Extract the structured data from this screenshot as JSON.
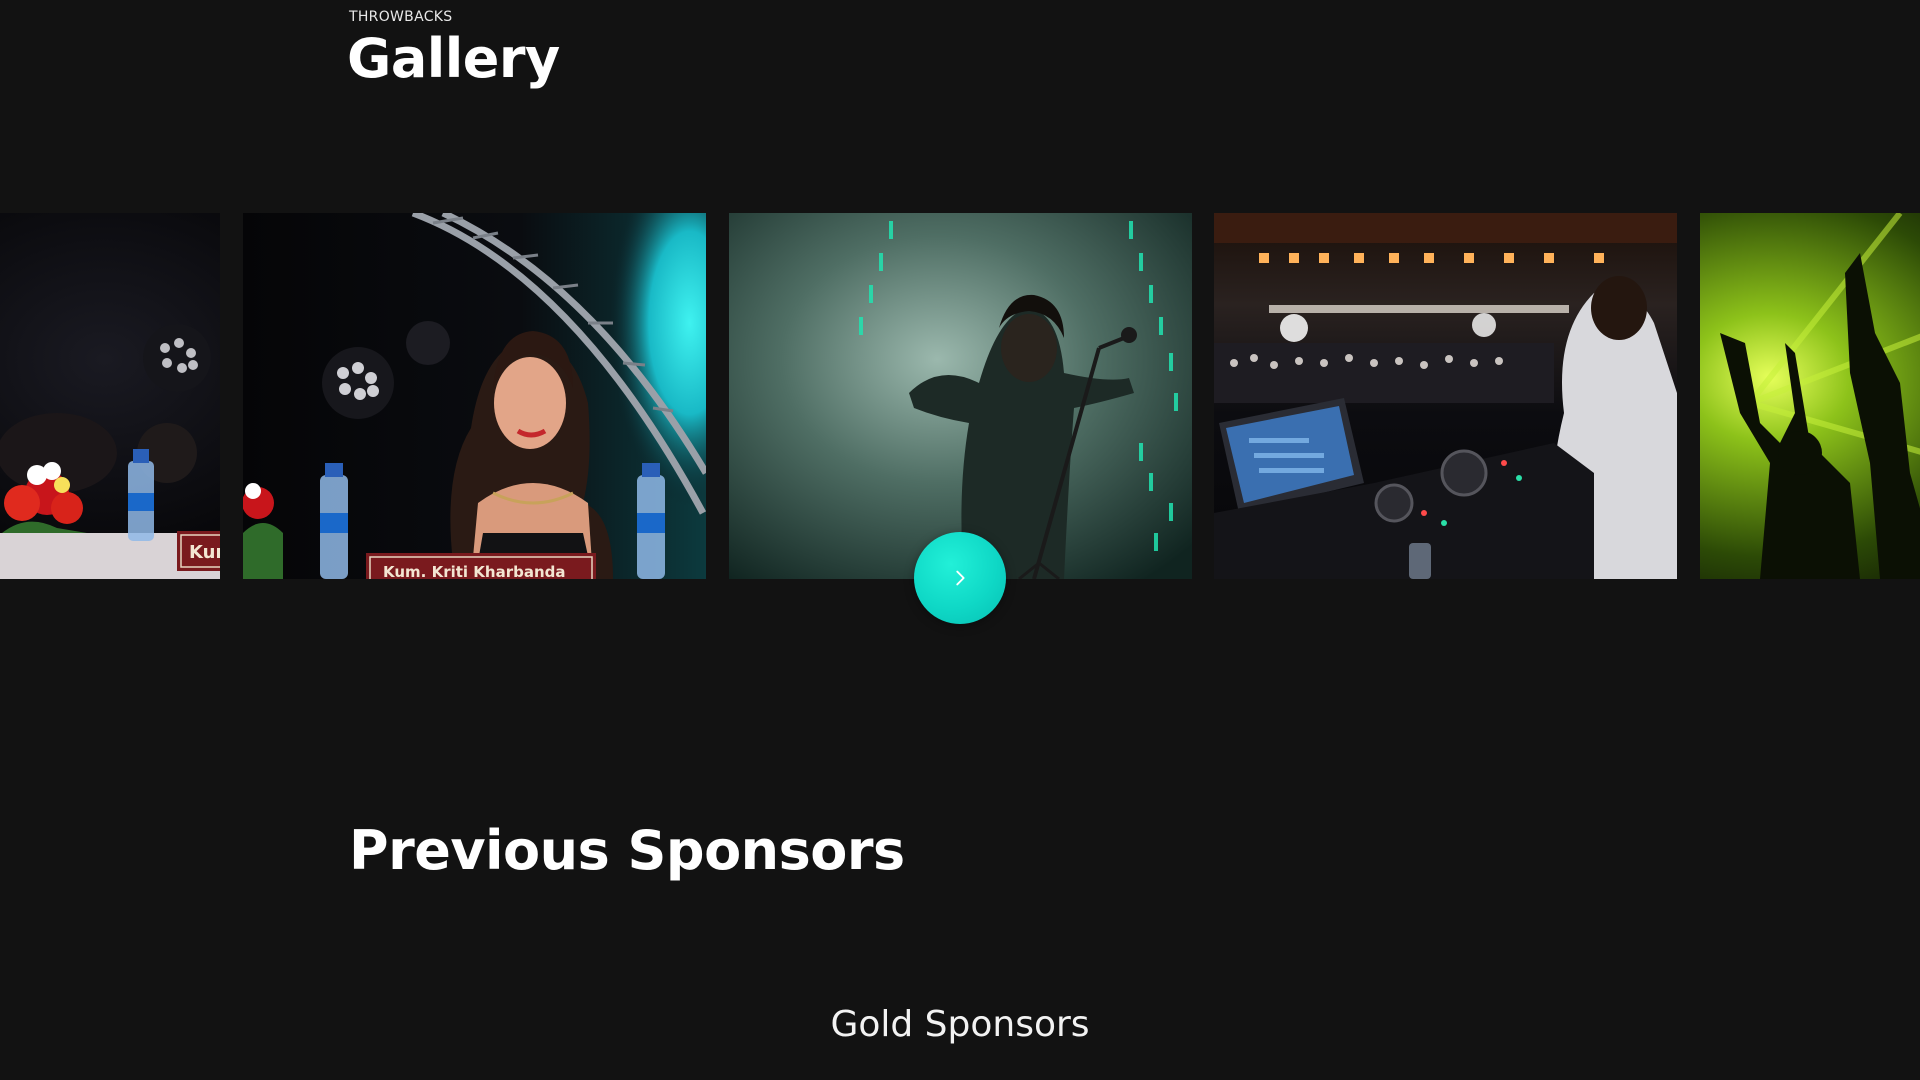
{
  "gallery": {
    "eyebrow": "THROWBACKS",
    "title": "Gallery",
    "slides": [
      {
        "name": "slide-event-panel",
        "caption": "Kum"
      },
      {
        "name": "slide-guest-panel",
        "caption": "Kum. Kriti Kharbanda"
      },
      {
        "name": "slide-singer-on-stage",
        "caption": ""
      },
      {
        "name": "slide-dj-booth",
        "caption": ""
      },
      {
        "name": "slide-crowd-lights",
        "caption": ""
      }
    ],
    "next_icon": "chevron-right-icon"
  },
  "sponsors": {
    "title": "Previous Sponsors",
    "gold_title": "Gold Sponsors"
  },
  "colors": {
    "background": "#121212",
    "accent": "#14e0c8",
    "text": "#ffffff"
  }
}
